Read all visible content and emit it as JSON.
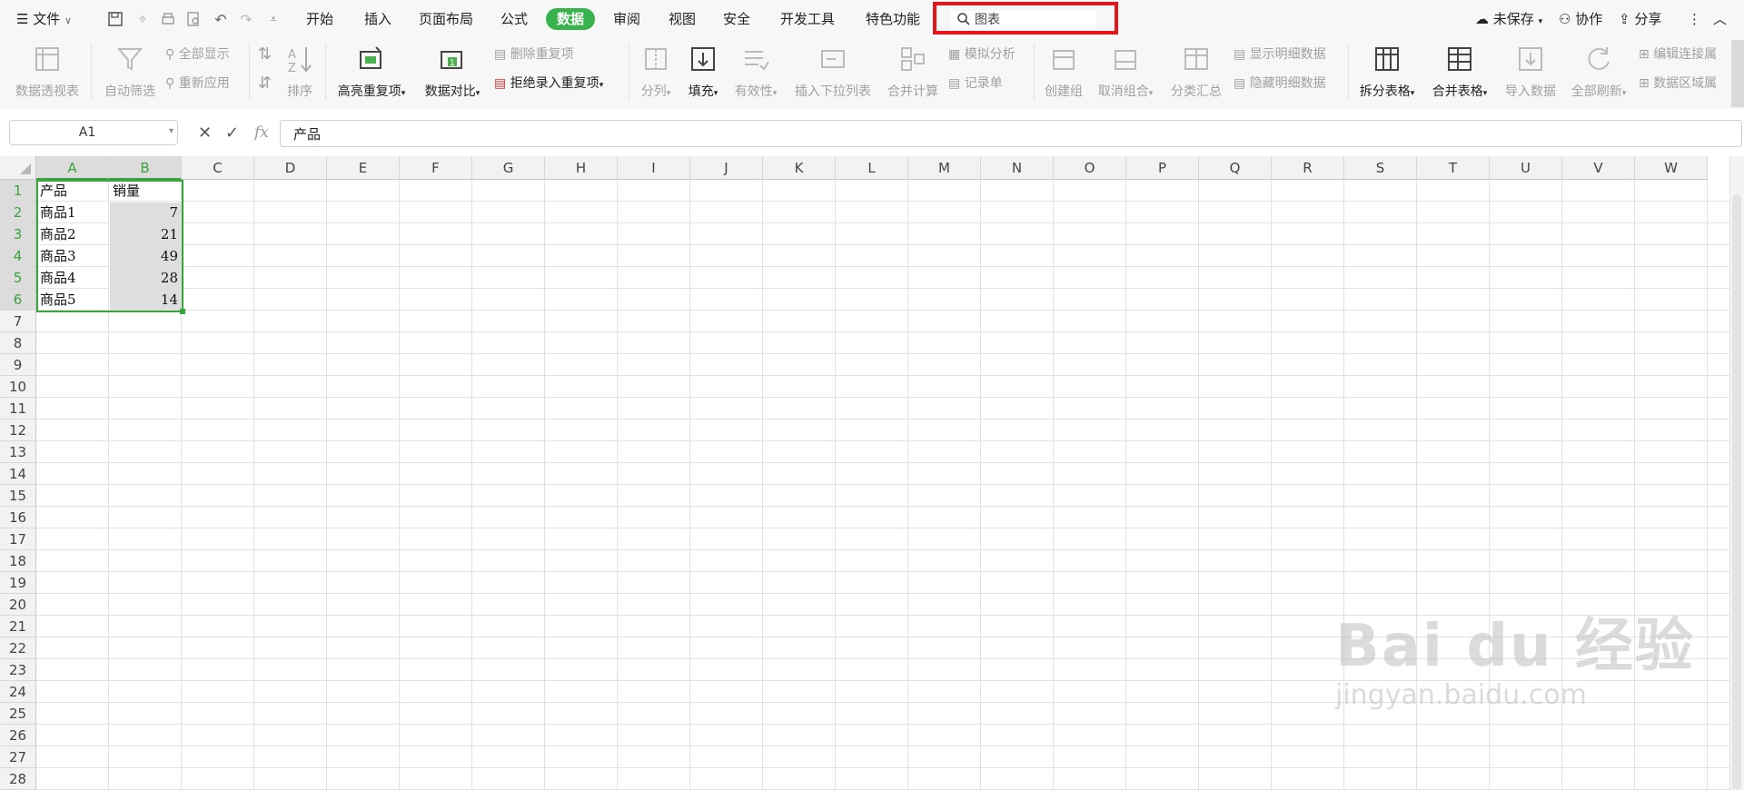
{
  "menubar": {
    "file_label": "文件",
    "tabs": [
      "开始",
      "插入",
      "页面布局",
      "公式",
      "数据",
      "审阅",
      "视图",
      "安全",
      "开发工具",
      "特色功能"
    ],
    "active_tab": "数据",
    "search_text": "图表",
    "unsaved_label": "未保存",
    "collab_label": "协作",
    "share_label": "分享"
  },
  "ribbon": {
    "pivot": "数据透视表",
    "autofilter": "自动筛选",
    "show_all": "全部显示",
    "reapply": "重新应用",
    "sort": "排序",
    "highlight_dup": "高亮重复项",
    "data_compare": "数据对比",
    "delete_dup": "删除重复项",
    "reject_dup": "拒绝录入重复项",
    "split": "分列",
    "fill": "填充",
    "validity": "有效性",
    "insert_dropdown": "插入下拉列表",
    "consolidate": "合并计算",
    "what_if": "模拟分析",
    "record": "记录单",
    "create_group": "创建组",
    "ungroup": "取消组合",
    "subtotal": "分类汇总",
    "show_detail": "显示明细数据",
    "hide_detail": "隐藏明细数据",
    "split_table": "拆分表格",
    "merge_table": "合并表格",
    "import_data": "导入数据",
    "refresh_all": "全部刷新",
    "edit_links": "编辑连接属",
    "data_range": "数据区域属"
  },
  "formula_bar": {
    "name_box": "A1",
    "fx": "fx",
    "value": "产品"
  },
  "columns": [
    "A",
    "B",
    "C",
    "D",
    "E",
    "F",
    "G",
    "H",
    "I",
    "J",
    "K",
    "L",
    "M",
    "N",
    "O",
    "P",
    "Q",
    "R",
    "S",
    "T",
    "U",
    "V",
    "W"
  ],
  "rows": [
    "1",
    "2",
    "3",
    "4",
    "5",
    "6",
    "7",
    "8",
    "9",
    "10",
    "11",
    "12",
    "13",
    "14",
    "15",
    "16",
    "17",
    "18",
    "19",
    "20",
    "21",
    "22",
    "23",
    "24",
    "25",
    "26",
    "27",
    "28"
  ],
  "sheet": {
    "a1": "产品",
    "b1": "销量",
    "a2": "商品1",
    "b2": "7",
    "a3": "商品2",
    "b3": "21",
    "a4": "商品3",
    "b4": "49",
    "a5": "商品4",
    "b5": "28",
    "a6": "商品5",
    "b6": "14"
  },
  "watermark": {
    "brand": "Bai du 经验",
    "url": "jingyan.baidu.com"
  },
  "colors": {
    "accent": "#37b24d",
    "highlight_box": "#e3161c"
  }
}
